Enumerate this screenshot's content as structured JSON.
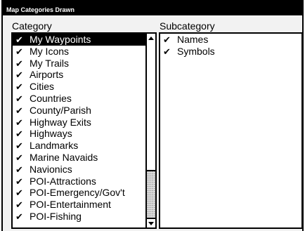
{
  "window": {
    "title": "Map Categories Drawn"
  },
  "category": {
    "header": "Category",
    "items": [
      {
        "label": "My Waypoints",
        "check": "✔",
        "selected": true
      },
      {
        "label": "My Icons",
        "check": "✔"
      },
      {
        "label": "My Trails",
        "check": "✔"
      },
      {
        "label": "Airports",
        "check": "✔"
      },
      {
        "label": "Cities",
        "check": "✔"
      },
      {
        "label": "Countries",
        "check": "✔"
      },
      {
        "label": "County/Parish",
        "check": "✔"
      },
      {
        "label": "Highway Exits",
        "check": "✔"
      },
      {
        "label": "Highways",
        "check": "✔"
      },
      {
        "label": "Landmarks",
        "check": "✔"
      },
      {
        "label": "Marine Navaids",
        "check": "✔"
      },
      {
        "label": "Navionics",
        "check": "✔"
      },
      {
        "label": "POI-Attractions",
        "check": "✔"
      },
      {
        "label": "POI-Emergency/Gov't",
        "check": "✔"
      },
      {
        "label": "POI-Entertainment",
        "check": "✔"
      },
      {
        "label": "POI-Fishing",
        "check": "✔"
      }
    ],
    "scroll_position": 0
  },
  "subcategory": {
    "header": "Subcategory",
    "items": [
      {
        "label": "Names",
        "check": "✔"
      },
      {
        "label": "Symbols",
        "check": "✔"
      }
    ]
  }
}
